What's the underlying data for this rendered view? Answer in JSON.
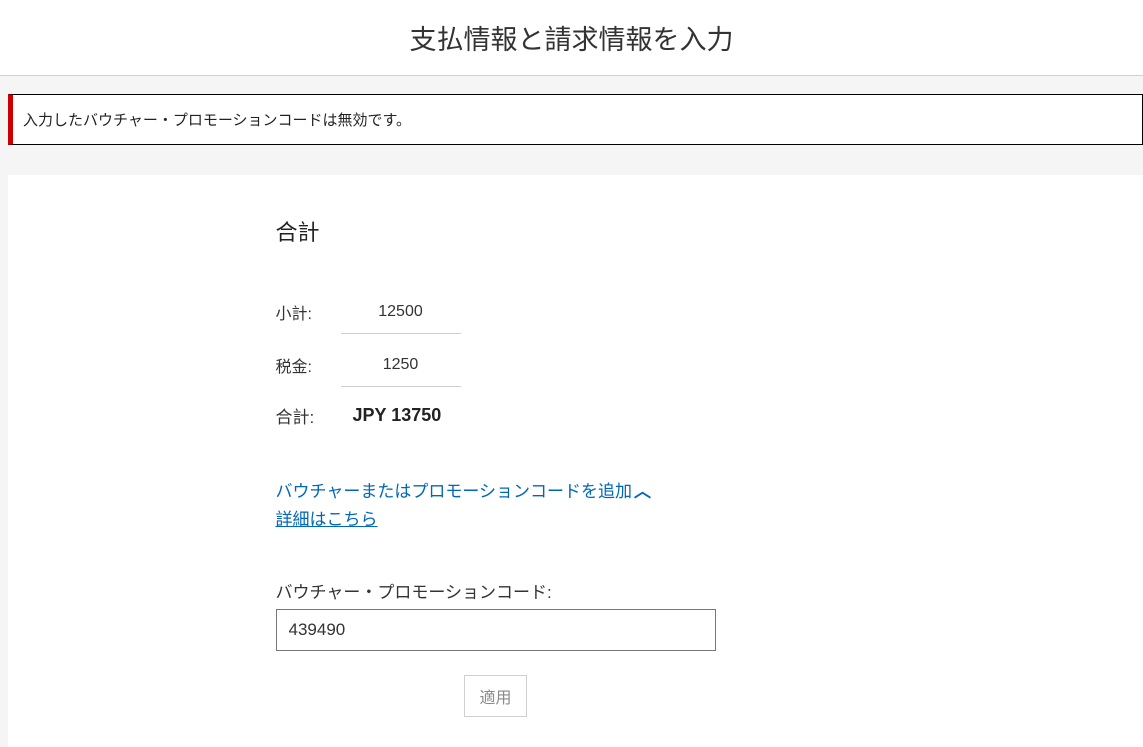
{
  "header": {
    "title": "支払情報と請求情報を入力"
  },
  "alert": {
    "message": "入力したバウチャー・プロモーションコードは無効です。"
  },
  "summary": {
    "heading": "合計",
    "subtotal_label": "小計:",
    "subtotal_value": "12500",
    "tax_label": "税金:",
    "tax_value": "1250",
    "total_label": "合計:",
    "total_value": "JPY 13750"
  },
  "promo": {
    "toggle_label": "バウチャーまたはプロモーションコードを追加",
    "details_link": "詳細はこちら",
    "field_label": "バウチャー・プロモーションコード:",
    "field_value": "439490",
    "apply_label": "適用"
  }
}
